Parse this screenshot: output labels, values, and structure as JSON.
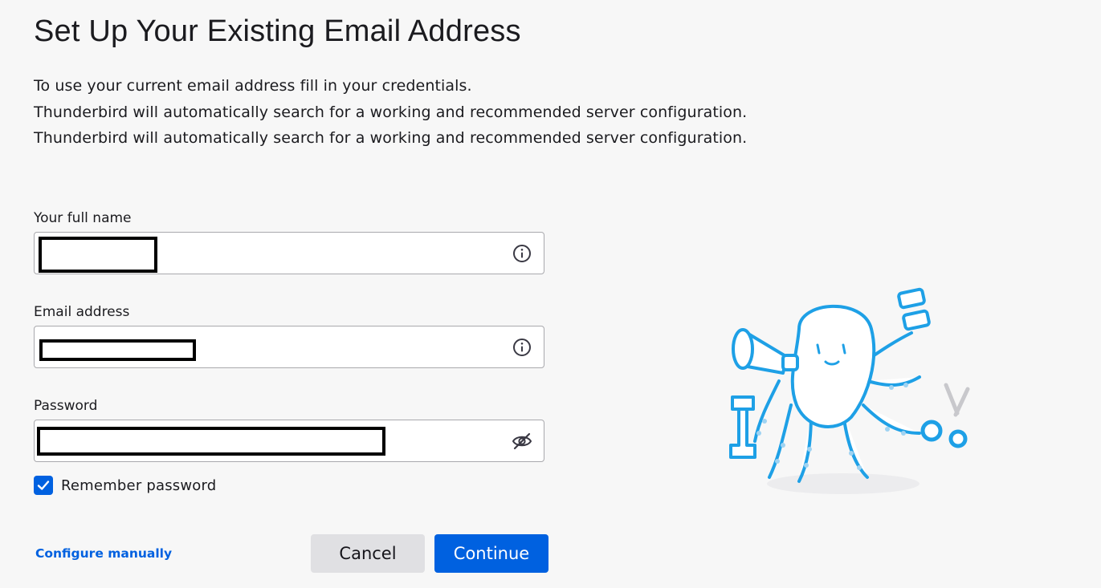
{
  "page": {
    "title": "Set Up Your Existing Email Address",
    "description": [
      "To use your current email address fill in your credentials.",
      "Thunderbird will automatically search for a working and recommended server configuration.",
      "Thunderbird will automatically search for a working and recommended server configuration."
    ]
  },
  "form": {
    "name": {
      "label": "Your full name",
      "value": "",
      "icon": "info-icon"
    },
    "email": {
      "label": "Email address",
      "value": "",
      "icon": "info-icon"
    },
    "password": {
      "label": "Password",
      "value": "",
      "icon": "eye-slash-icon"
    },
    "remember": {
      "label": "Remember password",
      "checked": true
    }
  },
  "footer": {
    "configure_label": "Configure manually",
    "cancel_label": "Cancel",
    "continue_label": "Continue"
  },
  "colors": {
    "accent": "#0061e0",
    "illustration_blue": "#1ea0e6",
    "background": "#f7f7f7"
  }
}
